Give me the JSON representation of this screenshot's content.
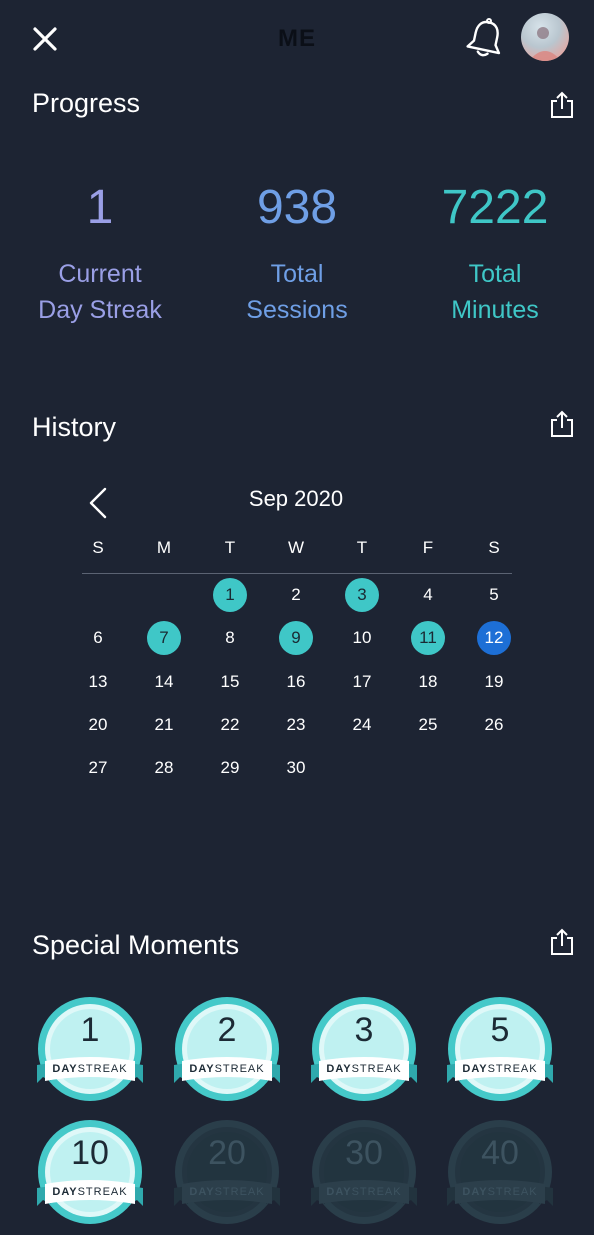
{
  "header": {
    "title": "ME"
  },
  "progress": {
    "title": "Progress",
    "stats": [
      {
        "value": "1",
        "line1": "Current",
        "line2": "Day Streak",
        "color": "#9a9fe6"
      },
      {
        "value": "938",
        "line1": "Total",
        "line2": "Sessions",
        "color": "#6f9fe6"
      },
      {
        "value": "7222",
        "line1": "Total",
        "line2": "Minutes",
        "color": "#3fc7c7"
      }
    ]
  },
  "history": {
    "title": "History",
    "month_label": "Sep 2020",
    "weekdays": [
      "S",
      "M",
      "T",
      "W",
      "T",
      "F",
      "S"
    ],
    "first_weekday": 2,
    "days_in_month": 30,
    "active_days": [
      1,
      3,
      7,
      9,
      11
    ],
    "today": 12
  },
  "special_moments": {
    "title": "Special Moments",
    "badges": [
      {
        "number": "1",
        "label_bold": "DAY",
        "label_rest": "STREAK",
        "unlocked": true
      },
      {
        "number": "2",
        "label_bold": "DAY",
        "label_rest": "STREAK",
        "unlocked": true
      },
      {
        "number": "3",
        "label_bold": "DAY",
        "label_rest": "STREAK",
        "unlocked": true
      },
      {
        "number": "5",
        "label_bold": "DAY",
        "label_rest": "STREAK",
        "unlocked": true
      },
      {
        "number": "10",
        "label_bold": "DAY",
        "label_rest": "STREAK",
        "unlocked": true
      },
      {
        "number": "20",
        "label_bold": "DAY",
        "label_rest": "STREAK",
        "unlocked": false
      },
      {
        "number": "30",
        "label_bold": "DAY",
        "label_rest": "STREAK",
        "unlocked": false
      },
      {
        "number": "40",
        "label_bold": "DAY",
        "label_rest": "STREAK",
        "unlocked": false
      }
    ]
  },
  "colors": {
    "background": "#1d2433",
    "accent_teal": "#3fc7c7",
    "today_blue": "#1d6fd6"
  },
  "icons": {
    "close": "close-icon",
    "bell": "bell-icon",
    "share": "share-icon",
    "prev": "chevron-left-icon"
  }
}
